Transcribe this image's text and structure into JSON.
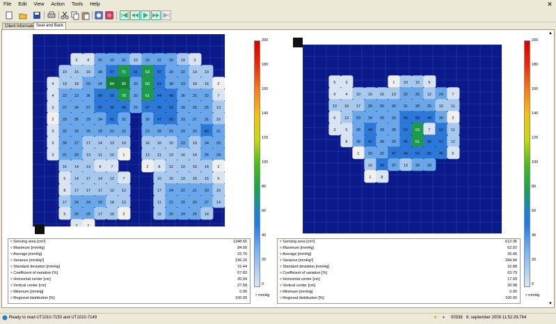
{
  "menu": [
    "File",
    "Edit",
    "View",
    "Action",
    "Tools",
    "Help"
  ],
  "toolbar_icons": [
    "new-document-icon",
    "open-folder-icon",
    "save-icon",
    "print-icon",
    "cut-icon",
    "copy-icon",
    "paste-icon",
    "record-icon",
    "stop-icon",
    "skip-first-icon",
    "step-back-icon",
    "play-icon",
    "step-forward-icon",
    "skip-last-icon"
  ],
  "tabs": [
    "Client Information",
    "Seat and Back"
  ],
  "scale": {
    "ticks": [
      "200",
      "180",
      "160",
      "140",
      "120",
      "100",
      "80",
      "60",
      "40",
      "20",
      "0"
    ],
    "unit": "mmHg"
  },
  "left_stats": {
    "labels": [
      "Sensing area [cm²]",
      "Maximum [mmHg]",
      "Average [mmHg]",
      "Variance [mmHg²]",
      "Standard deviation [mmHg]",
      "Coefficient of variation [%]",
      "Horizontal center [cm]",
      "Vertical center [cm]",
      "Minimum [mmHg]",
      "Regional distribution [%]"
    ],
    "values": [
      "1348.65",
      "84.00",
      "22.76",
      "236.29",
      "15.44",
      "67.83",
      "20.94",
      "27.58",
      "0.00",
      "100.00"
    ]
  },
  "right_stats": {
    "labels": [
      "Sensing area [cm²]",
      "Maximum [mmHg]",
      "Average [mmHg]",
      "Variance [mmHg²]",
      "Standard deviation [mmHg]",
      "Coefficient of variation [%]",
      "Horizontal center [cm]",
      "Vertical center [cm]",
      "Minimum [mmHg]",
      "Regional distribution [%]"
    ],
    "values": [
      "612.36",
      "62.92",
      "26.46",
      "284.94",
      "16.88",
      "63.79",
      "17.99",
      "20.98",
      "0.00",
      "100.00"
    ]
  },
  "status": {
    "message": "Ready to read UT1010-7150 and UT1010-7149",
    "count": "00338",
    "datetime": "8. september 2009 11:52:29,764"
  },
  "left_map": {
    "rows": [
      [
        "",
        "",
        "",
        "3",
        "8",
        "25",
        "23",
        "31",
        "10",
        "33",
        "22",
        "20",
        "10",
        "3",
        "",
        ""
      ],
      [
        "",
        "",
        "10",
        "15",
        "19",
        "34",
        "47",
        "71",
        "51",
        "63",
        "47",
        "28",
        "22",
        "14",
        "10",
        ""
      ],
      [
        "",
        "4",
        "19",
        "18",
        "29",
        "34",
        "84",
        "85",
        "20",
        "60",
        "53",
        "38",
        "23",
        "18",
        "16",
        "2"
      ],
      [
        "",
        "4",
        "22",
        "23",
        "36",
        "49",
        "59",
        "78",
        "30",
        "61",
        "44",
        "45",
        "36",
        "25",
        "22",
        "7"
      ],
      [
        "",
        "3",
        "27",
        "34",
        "37",
        "47",
        "56",
        "49",
        "25",
        "47",
        "45",
        "53",
        "39",
        "26",
        "25",
        "13"
      ],
      [
        "",
        "2",
        "29",
        "35",
        "29",
        "34",
        "42",
        "31",
        "",
        "36",
        "47",
        "50",
        "33",
        "27",
        "31",
        "16"
      ],
      [
        "",
        "3",
        "32",
        "33",
        "25",
        "23",
        "22",
        "22",
        "",
        "23",
        "28",
        "25",
        "29",
        "20",
        "40",
        "31"
      ],
      [
        "",
        "3",
        "30",
        "27",
        "17",
        "14",
        "13",
        "10",
        "",
        "16",
        "16",
        "15",
        "23",
        "19",
        "34",
        "23"
      ],
      [
        "",
        "3",
        "21",
        "20",
        "13",
        "11",
        "10",
        "1",
        "",
        "12",
        "11",
        "13",
        "16",
        "14",
        "25",
        "24"
      ],
      [
        "",
        "",
        "16",
        "14",
        "13",
        "8",
        "7",
        "",
        "",
        "2",
        "8",
        "12",
        "10",
        "16",
        "14",
        "2"
      ],
      [
        "",
        "",
        "5",
        "14",
        "17",
        "14",
        "12",
        "7",
        "",
        "",
        "10",
        "16",
        "19",
        "15",
        "15",
        "9"
      ],
      [
        "",
        "",
        "8",
        "17",
        "17",
        "17",
        "12",
        "12",
        "",
        "",
        "17",
        "24",
        "22",
        "21",
        "20",
        "16"
      ],
      [
        "",
        "",
        "17",
        "24",
        "24",
        "23",
        "18",
        "12",
        "",
        "",
        "11",
        "21",
        "20",
        "20",
        "27",
        "14"
      ],
      [
        "",
        "",
        "5",
        "20",
        "25",
        "17",
        "19",
        "2",
        "",
        "",
        "15",
        "20",
        "24",
        "25",
        "14",
        ""
      ],
      [
        "",
        "",
        "",
        "3",
        "2",
        "",
        "",
        "",
        "",
        "",
        "",
        "",
        "",
        "",
        "",
        ""
      ]
    ]
  },
  "right_map": {
    "rows": [
      [
        "",
        "",
        "",
        "",
        "",
        "",
        "",
        "",
        "",
        "",
        "",
        "",
        "",
        "",
        "",
        ""
      ],
      [
        "",
        "",
        "5",
        "3",
        "",
        "",
        "",
        "1",
        "10",
        "15",
        "9",
        "",
        "",
        "",
        "",
        ""
      ],
      [
        "",
        "",
        "9",
        "4",
        "10",
        "16",
        "16",
        "13",
        "22",
        "25",
        "12",
        "24",
        "7",
        "",
        "",
        ""
      ],
      [
        "",
        "",
        "13",
        "18",
        "17",
        "29",
        "26",
        "30",
        "31",
        "28",
        "25",
        "10",
        "11",
        "",
        "",
        ""
      ],
      [
        "",
        "",
        "6",
        "13",
        "20",
        "34",
        "20",
        "29",
        "45",
        "56",
        "44",
        "30",
        "2",
        "",
        "",
        ""
      ],
      [
        "",
        "",
        "3",
        "5",
        "28",
        "44",
        "33",
        "35",
        "52",
        "63",
        "7",
        "52",
        "11",
        "",
        "",
        ""
      ],
      [
        "",
        "",
        "",
        "8",
        "38",
        "41",
        "38",
        "29",
        "45",
        "61",
        "58",
        "57",
        "12",
        "",
        "",
        ""
      ],
      [
        "",
        "",
        "",
        "",
        "1",
        "20",
        "32",
        "47",
        "44",
        "53",
        "55",
        "45",
        "5",
        "",
        "",
        ""
      ],
      [
        "",
        "",
        "",
        "",
        "",
        "19",
        "40",
        "37",
        "13",
        "39",
        "28",
        "",
        "",
        "",
        "",
        ""
      ],
      [
        "",
        "",
        "",
        "",
        "",
        "1",
        "8",
        "",
        "",
        "",
        "",
        "",
        "",
        "",
        "",
        ""
      ]
    ]
  }
}
